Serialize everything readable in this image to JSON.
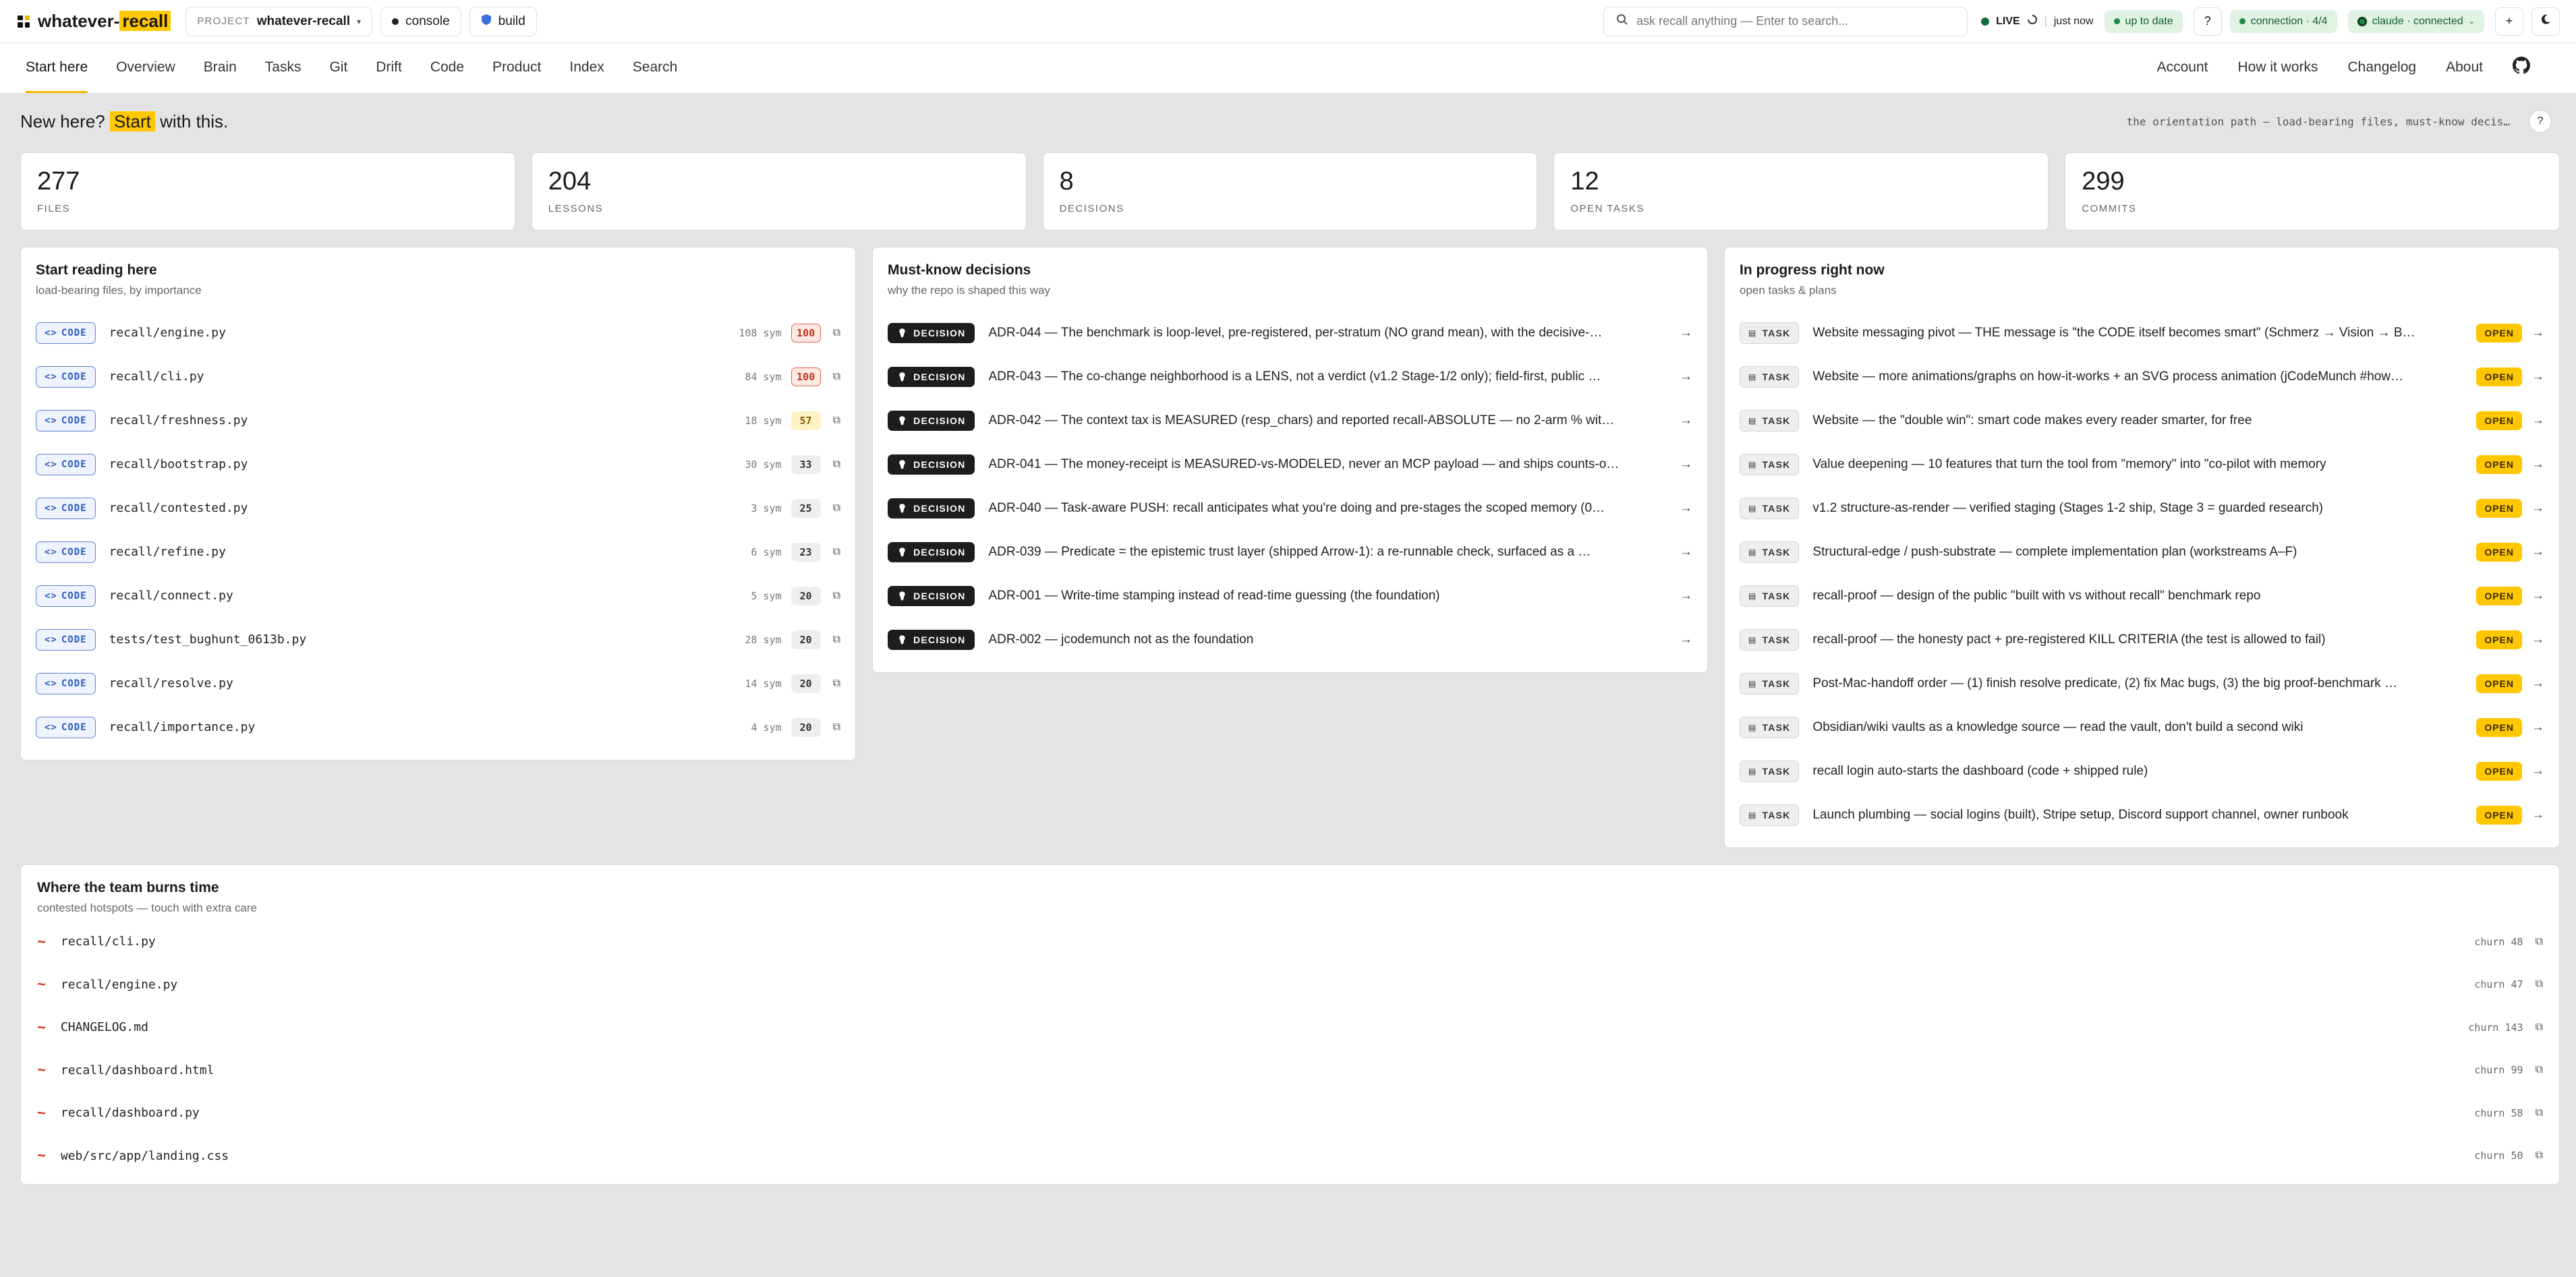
{
  "brand": {
    "name_part1": "whatever-",
    "name_part2": "recall"
  },
  "topbar": {
    "project_label": "PROJECT",
    "project_name": "whatever-recall",
    "console_label": "console",
    "build_label": "build",
    "search_placeholder": "ask recall anything — Enter to search...",
    "live_label": "LIVE",
    "updated_label": "just now",
    "sync_label": "up to date",
    "help_label": "?",
    "connection_label": "connection · 4/4",
    "claude_label": "claude · connected",
    "add_label": "+",
    "colors": {
      "accent": "#ffc700",
      "live": "#176c3a",
      "sync_bg": "#dff2e4"
    }
  },
  "nav": {
    "left": [
      "Start here",
      "Overview",
      "Brain",
      "Tasks",
      "Git",
      "Drift",
      "Code",
      "Product",
      "Index",
      "Search"
    ],
    "right": [
      "Account",
      "How it works",
      "Changelog",
      "About"
    ]
  },
  "header": {
    "title_pre": "New here? ",
    "title_hl": "Start",
    "title_post": " with this.",
    "orientation": "the orientation path — load-bearing files, must-know decis…",
    "help": "?"
  },
  "stats": [
    {
      "value": "277",
      "label": "FILES"
    },
    {
      "value": "204",
      "label": "LESSONS"
    },
    {
      "value": "8",
      "label": "DECISIONS"
    },
    {
      "value": "12",
      "label": "OPEN TASKS"
    },
    {
      "value": "299",
      "label": "COMMITS"
    }
  ],
  "reading": {
    "title": "Start reading here",
    "subtitle": "load-bearing files, by importance",
    "tag": "CODE",
    "items": [
      {
        "path": "recall/engine.py",
        "sym": "108 sym",
        "score": "100",
        "level": "red"
      },
      {
        "path": "recall/cli.py",
        "sym": "84 sym",
        "score": "100",
        "level": "red"
      },
      {
        "path": "recall/freshness.py",
        "sym": "18 sym",
        "score": "57",
        "level": "yellow"
      },
      {
        "path": "recall/bootstrap.py",
        "sym": "30 sym",
        "score": "33",
        "level": "grey"
      },
      {
        "path": "recall/contested.py",
        "sym": "3 sym",
        "score": "25",
        "level": "grey"
      },
      {
        "path": "recall/refine.py",
        "sym": "6 sym",
        "score": "23",
        "level": "grey"
      },
      {
        "path": "recall/connect.py",
        "sym": "5 sym",
        "score": "20",
        "level": "grey"
      },
      {
        "path": "tests/test_bughunt_0613b.py",
        "sym": "28 sym",
        "score": "20",
        "level": "grey"
      },
      {
        "path": "recall/resolve.py",
        "sym": "14 sym",
        "score": "20",
        "level": "grey"
      },
      {
        "path": "recall/importance.py",
        "sym": "4 sym",
        "score": "20",
        "level": "grey"
      }
    ]
  },
  "decisions": {
    "title": "Must-know decisions",
    "subtitle": "why the repo is shaped this way",
    "tag": "DECISION",
    "items": [
      "ADR-044 — The benchmark is loop-level, pre-registered, per-stratum (NO grand mean), with the decisive-…",
      "ADR-043 — The co-change neighborhood is a LENS, not a verdict (v1.2 Stage-1/2 only); field-first, public …",
      "ADR-042 — The context tax is MEASURED (resp_chars) and reported recall-ABSOLUTE — no 2-arm % wit…",
      "ADR-041 — The money-receipt is MEASURED-vs-MODELED, never an MCP payload — and ships counts-o…",
      "ADR-040 — Task-aware PUSH: recall anticipates what you're doing and pre-stages the scoped memory (0…",
      "ADR-039 — Predicate = the epistemic trust layer (shipped Arrow-1): a re-runnable check, surfaced as a …",
      "ADR-001 — Write-time stamping instead of read-time guessing (the foundation)",
      "ADR-002 — jcodemunch not as the foundation"
    ]
  },
  "tasks": {
    "title": "In progress right now",
    "subtitle": "open tasks & plans",
    "tag": "TASK",
    "status": "OPEN",
    "items": [
      "Website messaging pivot — THE message is \"the CODE itself becomes smart\" (Schmerz → Vision → B…",
      "Website — more animations/graphs on how-it-works + an SVG process animation (jCodeMunch #how…",
      "Website — the \"double win\": smart code makes every reader smarter, for free",
      "Value deepening — 10 features that turn the tool from \"memory\" into \"co-pilot with memory",
      "v1.2 structure-as-render — verified staging (Stages 1-2 ship, Stage 3 = guarded research)",
      "Structural-edge / push-substrate — complete implementation plan (workstreams A–F)",
      "recall-proof — design of the public \"built with vs without recall\" benchmark repo",
      "recall-proof — the honesty pact + pre-registered KILL CRITERIA (the test is allowed to fail)",
      "Post-Mac-handoff order — (1) finish resolve predicate, (2) fix Mac bugs, (3) the big proof-benchmark …",
      "Obsidian/wiki vaults as a knowledge source — read the vault, don't build a second wiki",
      "recall login auto-starts the dashboard (code + shipped rule)",
      "Launch plumbing — social logins (built), Stripe setup, Discord support channel, owner runbook"
    ]
  },
  "burn": {
    "title": "Where the team burns time",
    "subtitle": "contested hotspots — touch with extra care",
    "items": [
      {
        "path": "recall/cli.py",
        "churn": "churn 48"
      },
      {
        "path": "recall/engine.py",
        "churn": "churn 47"
      },
      {
        "path": "CHANGELOG.md",
        "churn": "churn 143"
      },
      {
        "path": "recall/dashboard.html",
        "churn": "churn 99"
      },
      {
        "path": "recall/dashboard.py",
        "churn": "churn 58"
      },
      {
        "path": "web/src/app/landing.css",
        "churn": "churn 50"
      }
    ]
  }
}
